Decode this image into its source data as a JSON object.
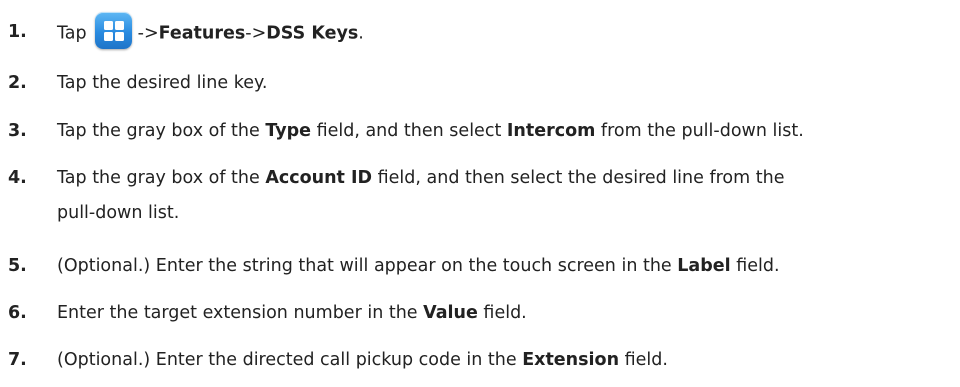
{
  "steps": [
    {
      "number": "1.",
      "tap": "Tap",
      "icon": "apps-grid-icon",
      "arrow1": "->",
      "features": "Features",
      "arrow2": "->",
      "dss_keys": "DSS Keys",
      "end": "."
    },
    {
      "number": "2.",
      "text": "Tap the desired line key."
    },
    {
      "number": "3.",
      "pre": "Tap the gray box of the ",
      "b1": "Type",
      "mid": " field, and then select ",
      "b2": "Intercom",
      "post": " from the pull-down list."
    },
    {
      "number": "4.",
      "pre": "Tap the gray box of the ",
      "b1": "Account ID",
      "post": " field, and then select the desired line from the",
      "cont": "pull-down list."
    },
    {
      "number": "5.",
      "pre": "(Optional.) Enter the string that will appear on the touch screen in the ",
      "b1": "Label",
      "post": " field."
    },
    {
      "number": "6.",
      "pre": "Enter the target extension number in the ",
      "b1": "Value",
      "post": " field."
    },
    {
      "number": "7.",
      "pre": "(Optional.) Enter the directed call pickup code in the ",
      "b1": "Extension",
      "post": " field."
    }
  ],
  "colors": {
    "text": "#222222",
    "icon_blue": "#2a8be0"
  }
}
